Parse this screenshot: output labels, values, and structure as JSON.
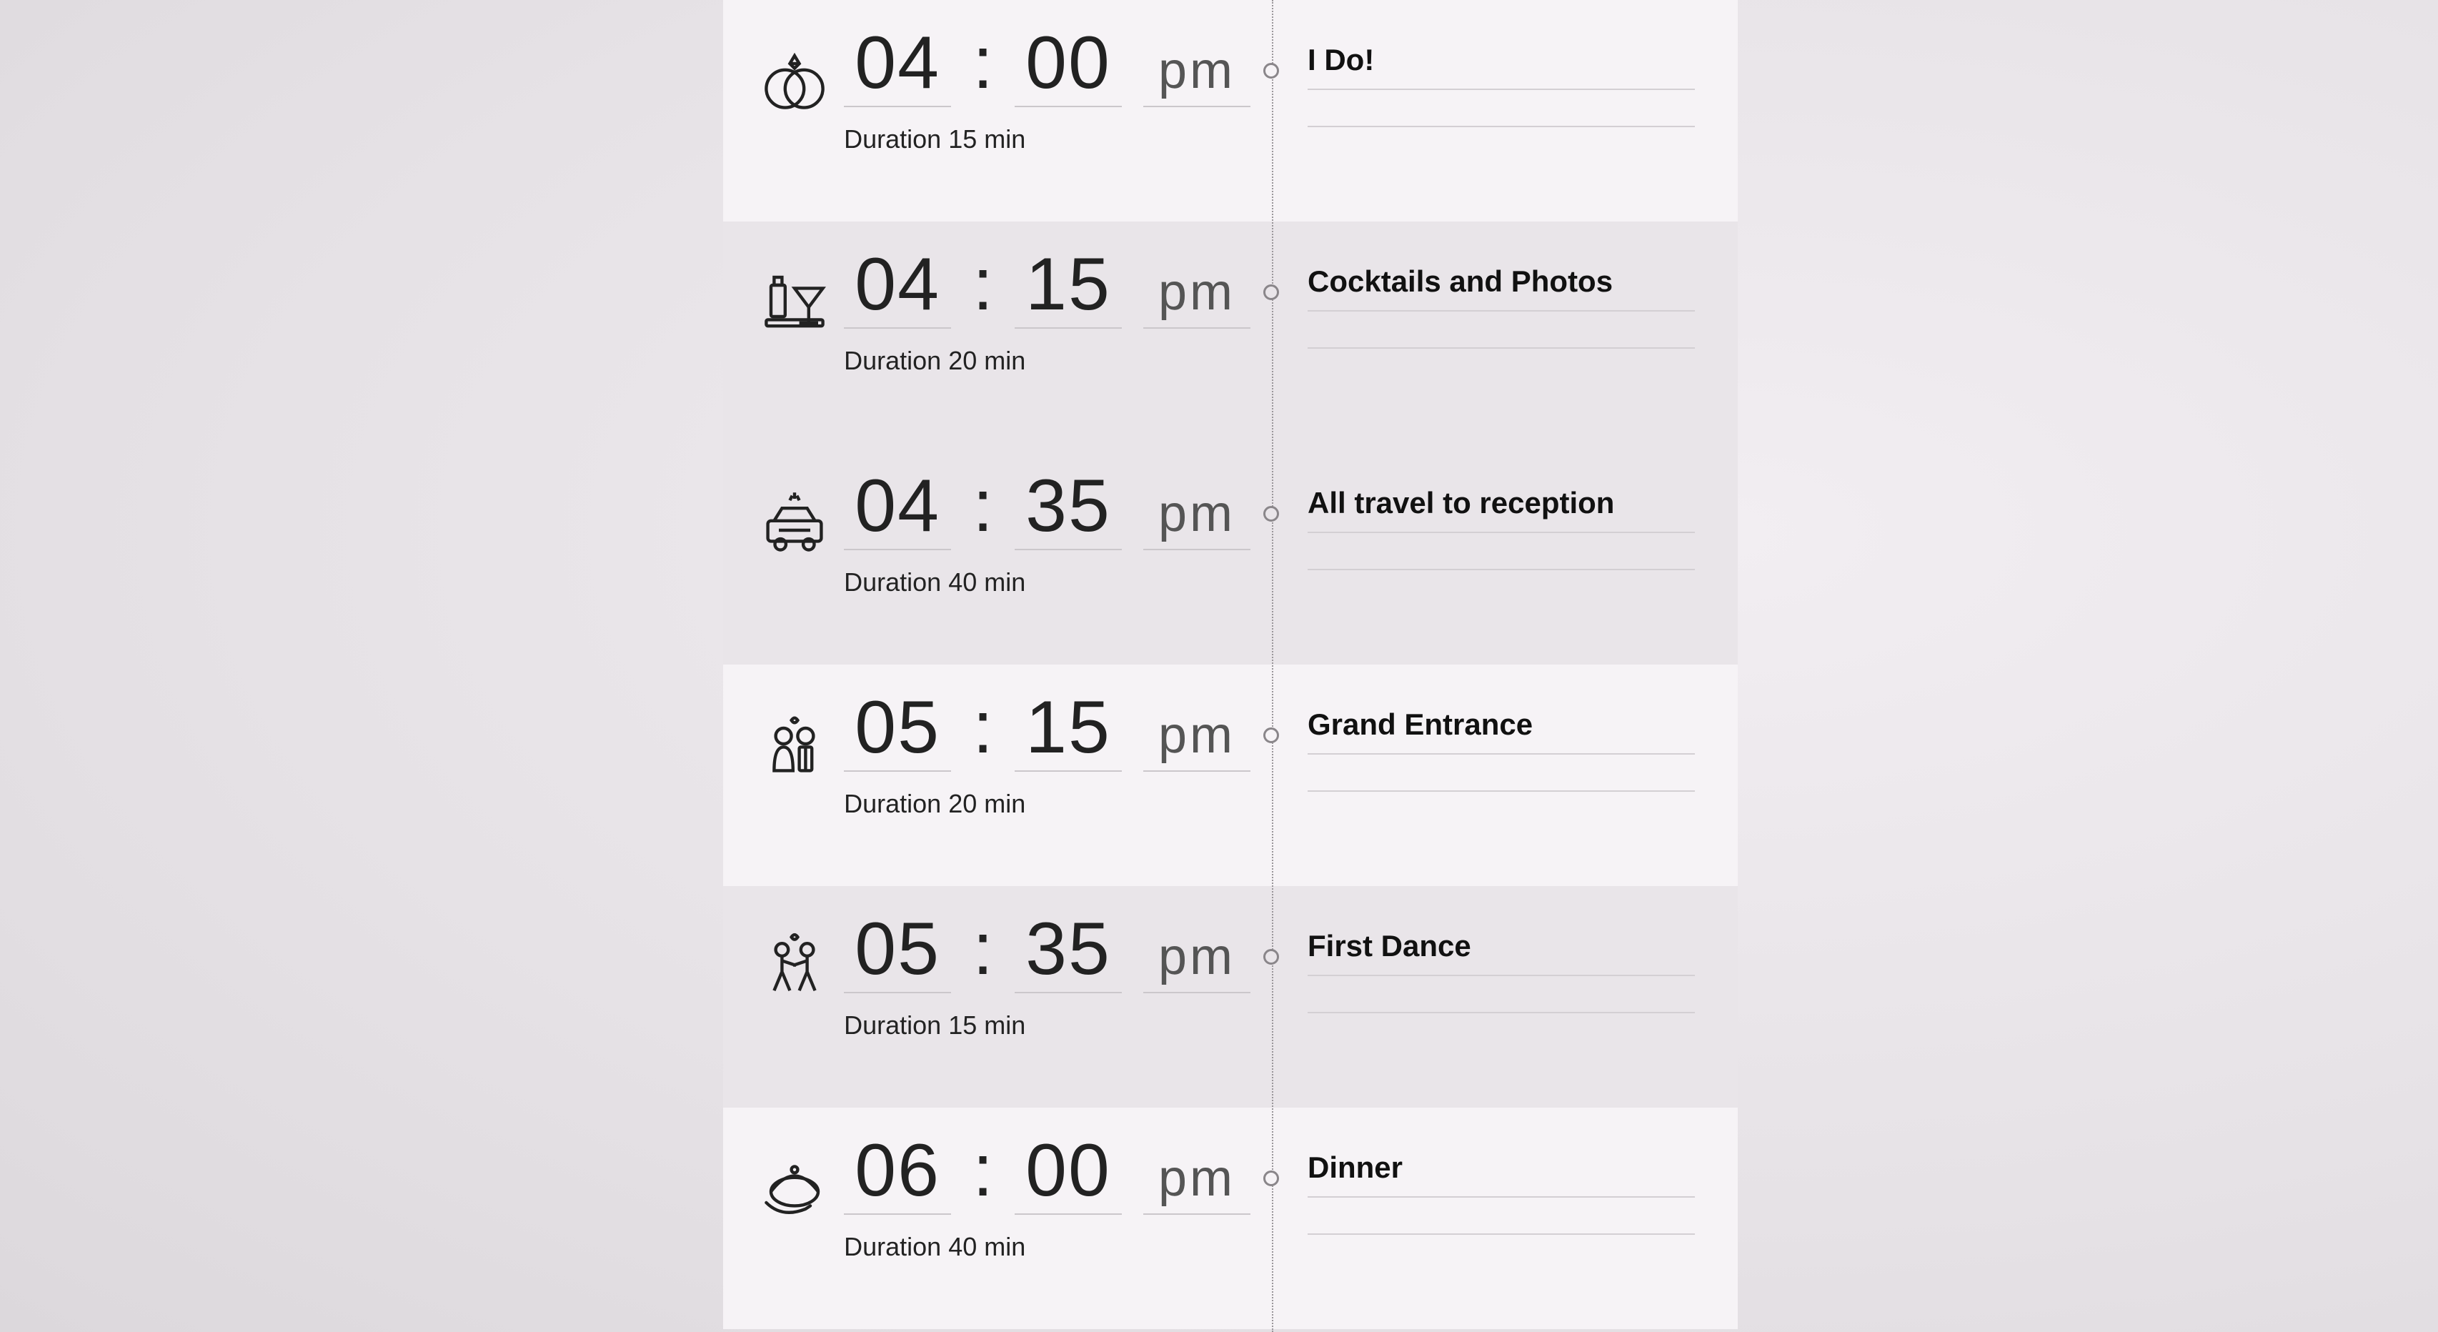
{
  "duration_prefix": "Duration",
  "events": [
    {
      "icon": "rings",
      "hh": "04",
      "mm": "00",
      "ampm": "pm",
      "duration": "15 min",
      "title": "I Do!",
      "alt": true
    },
    {
      "icon": "drinks",
      "hh": "04",
      "mm": "15",
      "ampm": "pm",
      "duration": "20 min",
      "title": "Cocktails and Photos",
      "alt": false
    },
    {
      "icon": "car",
      "hh": "04",
      "mm": "35",
      "ampm": "pm",
      "duration": "40 min",
      "title": "All travel to reception",
      "alt": false
    },
    {
      "icon": "couple",
      "hh": "05",
      "mm": "15",
      "ampm": "pm",
      "duration": "20 min",
      "title": "Grand Entrance",
      "alt": true
    },
    {
      "icon": "dance",
      "hh": "05",
      "mm": "35",
      "ampm": "pm",
      "duration": "15 min",
      "title": "First Dance",
      "alt": false
    },
    {
      "icon": "dinner",
      "hh": "06",
      "mm": "00",
      "ampm": "pm",
      "duration": "40 min",
      "title": "Dinner",
      "alt": true
    }
  ]
}
